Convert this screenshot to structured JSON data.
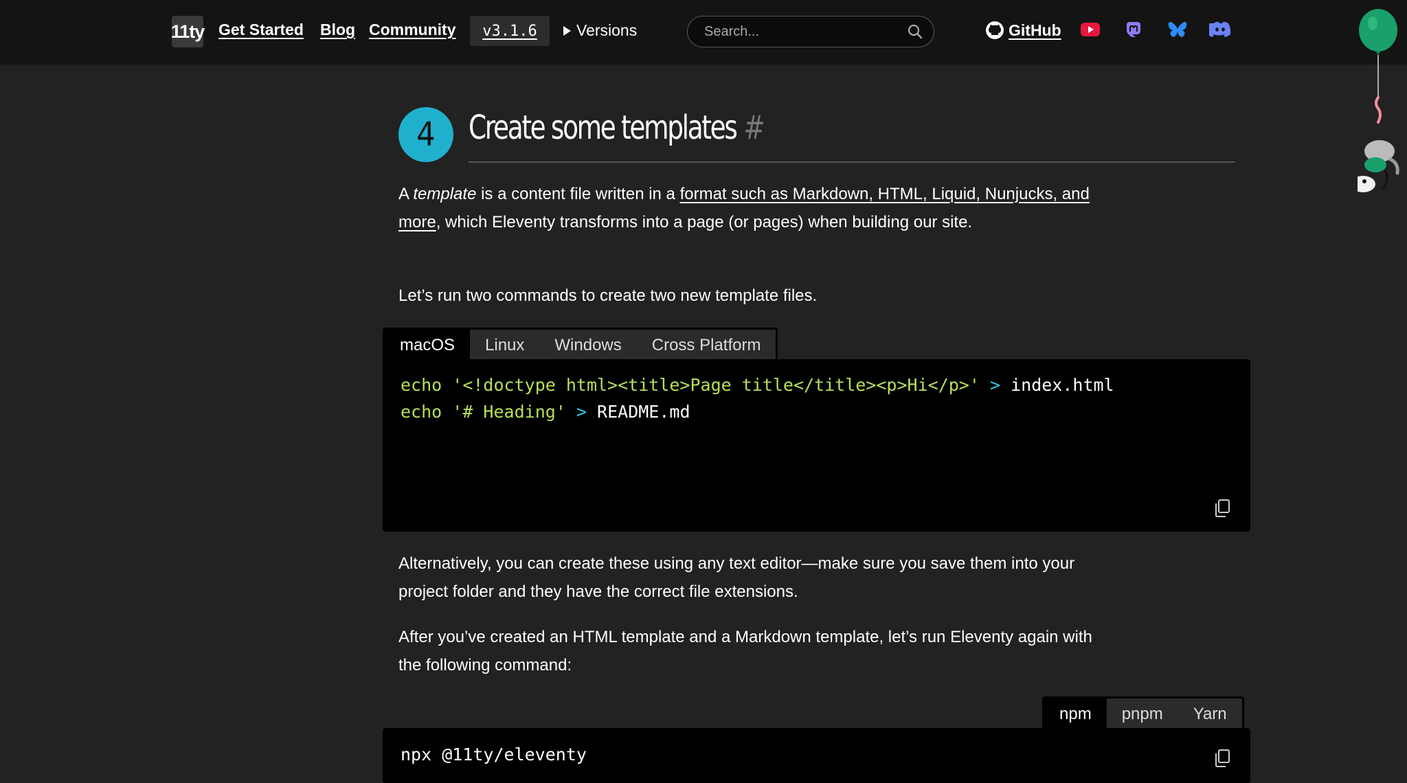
{
  "header": {
    "logo": "11ty",
    "nav": [
      "Get Started",
      "Blog",
      "Community"
    ],
    "version": "v3.1.6",
    "versions_label": "Versions",
    "search_placeholder": "Search...",
    "github_label": "GitHub",
    "social_icons": [
      "youtube-icon",
      "mastodon-icon",
      "bluesky-icon",
      "discord-icon"
    ]
  },
  "section": {
    "step_number": "4",
    "heading": "Create some templates",
    "anchor": "#"
  },
  "paragraphs": {
    "p1_a": "A ",
    "p1_em": "template",
    "p1_b": " is a content file written in a ",
    "p1_link": "format such as Markdown, HTML, Liquid, Nunjucks, and more",
    "p1_c": ", which Eleventy transforms into a page (or pages) when building our site.",
    "p2": "Let’s run two commands to create two new template files.",
    "p3": "Alternatively, you can create these using any text editor—make sure you save them into your project folder and they have the correct file extensions.",
    "p4": "After you’ve created an HTML template and a Markdown template, let’s run Eleventy again with the following command:"
  },
  "os_tabs": [
    "macOS",
    "Linux",
    "Windows",
    "Cross Platform"
  ],
  "code1": {
    "line1": {
      "cmd": "echo",
      "str": "'<!doctype html><title>Page title</title><p>Hi</p>'",
      "op": ">",
      "file": "index.html"
    },
    "line2": {
      "cmd": "echo",
      "str": "'# Heading'",
      "op": ">",
      "file": "README.md"
    }
  },
  "pm_tabs": [
    "npm",
    "pnpm",
    "Yarn"
  ],
  "code2": {
    "line1": "npx @11ty/eleventy"
  },
  "colors": {
    "accent": "#1fb0ce",
    "string": "#b6e05a",
    "operator": "#37c6f0",
    "balloon": "#1aa06a"
  }
}
